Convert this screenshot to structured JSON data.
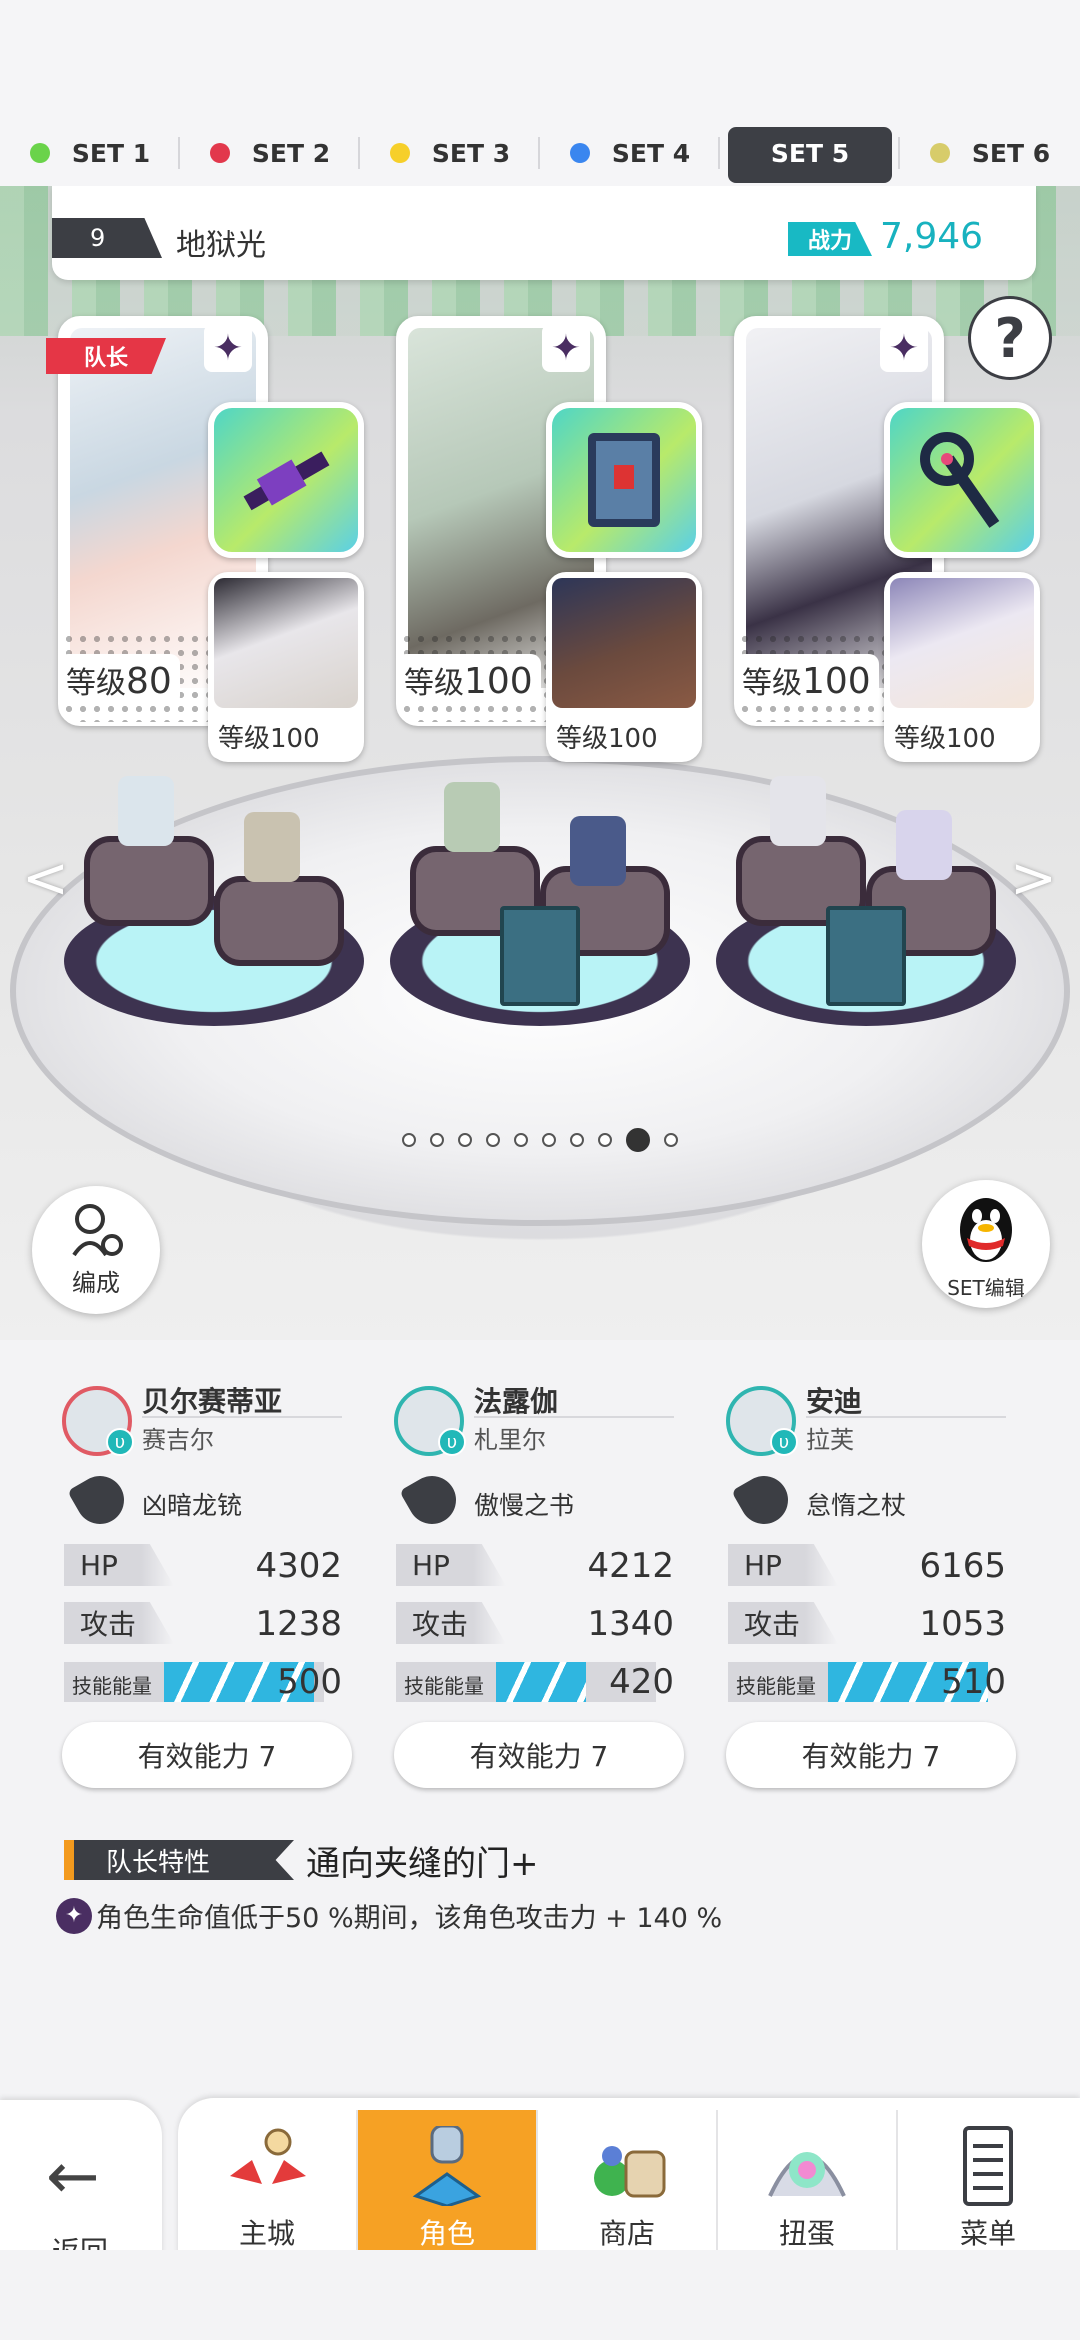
{
  "set_tabs": [
    {
      "label": "SET 1",
      "color": "#6ad34a",
      "active": false
    },
    {
      "label": "SET 2",
      "color": "#e2384c",
      "active": false
    },
    {
      "label": "SET 3",
      "color": "#f6cf2a",
      "active": false
    },
    {
      "label": "SET 4",
      "color": "#3a86ef",
      "active": false
    },
    {
      "label": "SET 5",
      "color": "",
      "active": true
    },
    {
      "label": "SET 6",
      "color": "#d7cc6a",
      "active": false
    }
  ],
  "team": {
    "number": "9",
    "name": "地狱光",
    "power_label": "战力",
    "power_value": "7,946"
  },
  "help_icon": "question-mark-icon",
  "scene": {
    "leader_tag": "队长",
    "cards": [
      {
        "main_level_label": "等级",
        "main_level": "80",
        "sub_level_label": "等级",
        "sub_level": "100"
      },
      {
        "main_level_label": "等级",
        "main_level": "100",
        "sub_level_label": "等级",
        "sub_level": "100"
      },
      {
        "main_level_label": "等级",
        "main_level": "100",
        "sub_level_label": "等级",
        "sub_level": "100"
      }
    ],
    "page_dots": {
      "count": 10,
      "active_index": 8
    },
    "formation_label": "编成",
    "qq_label": "SET编辑"
  },
  "heroes": [
    {
      "name": "贝尔赛蒂亚",
      "sub": "赛吉尔",
      "weapon": "凶暗龙铳",
      "hp_label": "HP",
      "hp": "4302",
      "atk_label": "攻击",
      "atk": "1238",
      "energy_label": "技能能量",
      "energy": "500",
      "effect_label": "有效能力 7"
    },
    {
      "name": "法露伽",
      "sub": "札里尔",
      "weapon": "傲慢之书",
      "hp_label": "HP",
      "hp": "4212",
      "atk_label": "攻击",
      "atk": "1340",
      "energy_label": "技能能量",
      "energy": "420",
      "effect_label": "有效能力 7"
    },
    {
      "name": "安迪",
      "sub": "拉芙",
      "weapon": "怠惰之杖",
      "hp_label": "HP",
      "hp": "6165",
      "atk_label": "攻击",
      "atk": "1053",
      "energy_label": "技能能量",
      "energy": "510",
      "effect_label": "有效能力 7"
    }
  ],
  "leader_trait": {
    "tag": "队长特性",
    "name": "通向夹缝的门+",
    "description": "角色生命值低于50 %期间，该角色攻击力 + 140 %"
  },
  "bottom_nav": {
    "back_label": "返回",
    "items": [
      {
        "label": "主城",
        "icon": "castle-icon",
        "active": false
      },
      {
        "label": "角色",
        "icon": "character-icon",
        "active": true
      },
      {
        "label": "商店",
        "icon": "shop-bag-icon",
        "active": false
      },
      {
        "label": "扭蛋",
        "icon": "gacha-icon",
        "active": false
      },
      {
        "label": "菜单",
        "icon": "menu-list-icon",
        "active": false
      }
    ]
  }
}
